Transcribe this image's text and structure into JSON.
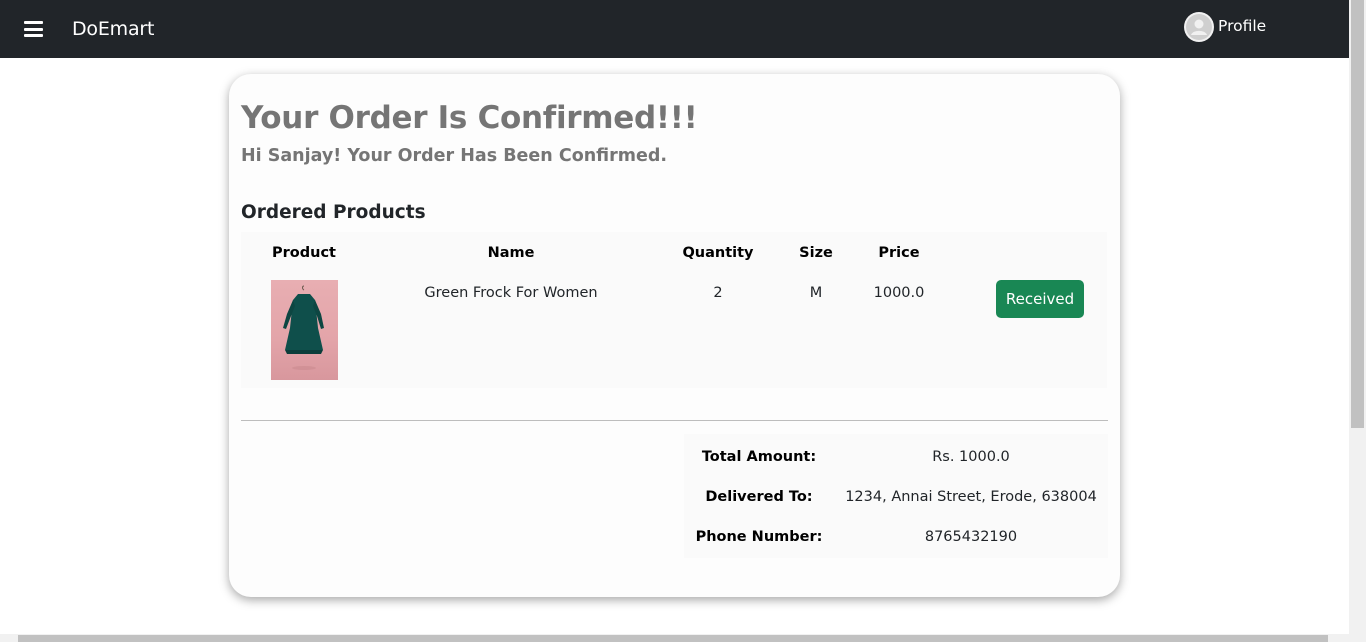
{
  "navbar": {
    "brand": "DoEmart",
    "profile_label": "Profile"
  },
  "order": {
    "heading": "Your Order Is Confirmed!!!",
    "subheading": "Hi Sanjay! Your Order Has Been Confirmed.",
    "section_title": "Ordered Products",
    "columns": [
      "Product",
      "Name",
      "Quantity",
      "Size",
      "Price"
    ],
    "items": [
      {
        "image": "green-frock-image",
        "name": "Green Frock For Women",
        "quantity": "2",
        "size": "M",
        "price": "1000.0",
        "status_button": "Received"
      }
    ]
  },
  "summary": {
    "total_label": "Total Amount:",
    "total_value": "Rs. 1000.0",
    "delivered_label": "Delivered To:",
    "delivered_value": "1234, Annai Street, Erode, 638004",
    "phone_label": "Phone Number:",
    "phone_value": "8765432190"
  },
  "colors": {
    "navbar_bg": "#212529",
    "heading_gray": "#757575",
    "success_green": "#198754"
  }
}
